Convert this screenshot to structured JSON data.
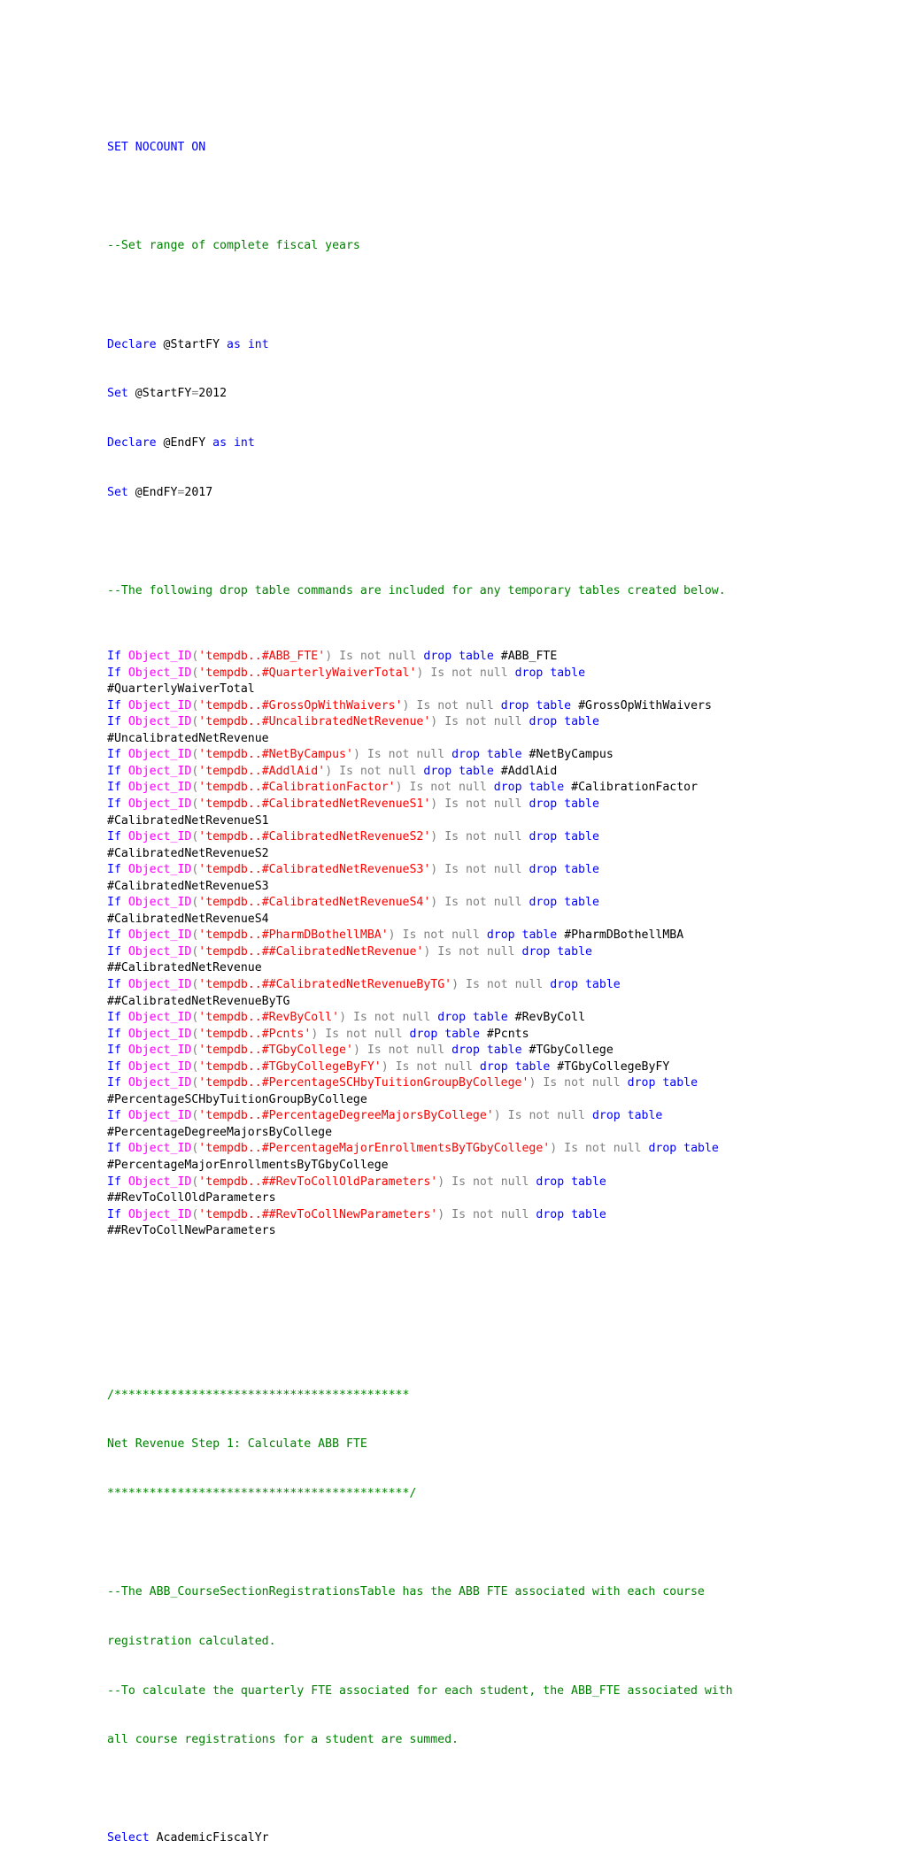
{
  "document": {
    "setup": {
      "set_nocount": "SET NOCOUNT ON",
      "comment_range": "--Set range of complete fiscal years",
      "declare_kw": "Declare",
      "set_kw": "Set",
      "as_kw": "as",
      "int_kw": "int",
      "start_var": "@StartFY",
      "start_value": "2012",
      "end_var": "@EndFY",
      "end_value": "2017",
      "equals": "="
    },
    "drop_comment": "--The following drop table commands are included for any temporary tables created below.",
    "drop_tokens": {
      "if_kw": "If",
      "func": "Object_ID",
      "open_paren": "(",
      "close_paren": ")",
      "is_not_null": "Is not null",
      "drop_table": "drop table"
    },
    "drop_statements": [
      {
        "arg": "'tempdb..#ABB_FTE'",
        "table": "#ABB_FTE",
        "wrap": false
      },
      {
        "arg": "'tempdb..#QuarterlyWaiverTotal'",
        "table": "#QuarterlyWaiverTotal",
        "wrap": true
      },
      {
        "arg": "'tempdb..#GrossOpWithWaivers'",
        "table": "#GrossOpWithWaivers",
        "wrap": false
      },
      {
        "arg": "'tempdb..#UncalibratedNetRevenue'",
        "table": "#UncalibratedNetRevenue",
        "wrap": true
      },
      {
        "arg": "'tempdb..#NetByCampus'",
        "table": "#NetByCampus",
        "wrap": false
      },
      {
        "arg": "'tempdb..#AddlAid'",
        "table": "#AddlAid",
        "wrap": false
      },
      {
        "arg": "'tempdb..#CalibrationFactor'",
        "table": "#CalibrationFactor",
        "wrap": false
      },
      {
        "arg": "'tempdb..#CalibratedNetRevenueS1'",
        "table": "#CalibratedNetRevenueS1",
        "wrap": true
      },
      {
        "arg": "'tempdb..#CalibratedNetRevenueS2'",
        "table": "#CalibratedNetRevenueS2",
        "wrap": true
      },
      {
        "arg": "'tempdb..#CalibratedNetRevenueS3'",
        "table": "#CalibratedNetRevenueS3",
        "wrap": true
      },
      {
        "arg": "'tempdb..#CalibratedNetRevenueS4'",
        "table": "#CalibratedNetRevenueS4",
        "wrap": true
      },
      {
        "arg": "'tempdb..#PharmDBothellMBA'",
        "table": "#PharmDBothellMBA",
        "wrap": false
      },
      {
        "arg": "'tempdb..##CalibratedNetRevenue'",
        "table": "##CalibratedNetRevenue",
        "wrap": true
      },
      {
        "arg": "'tempdb..##CalibratedNetRevenueByTG'",
        "table": "##CalibratedNetRevenueByTG",
        "wrap": true
      },
      {
        "arg": "'tempdb..#RevByColl'",
        "table": "#RevByColl",
        "wrap": false
      },
      {
        "arg": "'tempdb..#Pcnts'",
        "table": "#Pcnts",
        "wrap": false
      },
      {
        "arg": "'tempdb..#TGbyCollege'",
        "table": "#TGbyCollege",
        "wrap": false
      },
      {
        "arg": "'tempdb..#TGbyCollegeByFY'",
        "table": "#TGbyCollegeByFY",
        "wrap": false
      },
      {
        "arg": "'tempdb..#PercentageSCHbyTuitionGroupByCollege'",
        "table": "#PercentageSCHbyTuitionGroupByCollege",
        "wrap": true
      },
      {
        "arg": "'tempdb..#PercentageDegreeMajorsByCollege'",
        "table": "#PercentageDegreeMajorsByCollege",
        "wrap": true
      },
      {
        "arg": "'tempdb..#PercentageMajorEnrollmentsByTGbyCollege'",
        "table": "#PercentageMajorEnrollmentsByTGbyCollege",
        "wrap": true
      },
      {
        "arg": "'tempdb..##RevToCollOldParameters'",
        "table": "##RevToCollOldParameters",
        "wrap": true
      },
      {
        "arg": "'tempdb..##RevToCollNewParameters'",
        "table": "##RevToCollNewParameters",
        "wrap": true
      }
    ],
    "block_comment": {
      "top": "/******************************************",
      "title": "Net Revenue Step 1: Calculate ABB FTE",
      "bottom": "*******************************************/"
    },
    "step_comments": [
      "--The ABB_CourseSectionRegistrationsTable has the ABB FTE associated with each course",
      "registration calculated.",
      "--To calculate the quarterly FTE associated for each student, the ABB_FTE associated with",
      "all course registrations for a student are summed."
    ],
    "select_kw": "Select",
    "select_field": "AcademicFiscalYr"
  },
  "colors": {
    "keyword": "#0000ff",
    "function": "#ff00ff",
    "string": "#ff0000",
    "operator": "#808080",
    "comment": "#008000",
    "identifier": "#000000"
  }
}
